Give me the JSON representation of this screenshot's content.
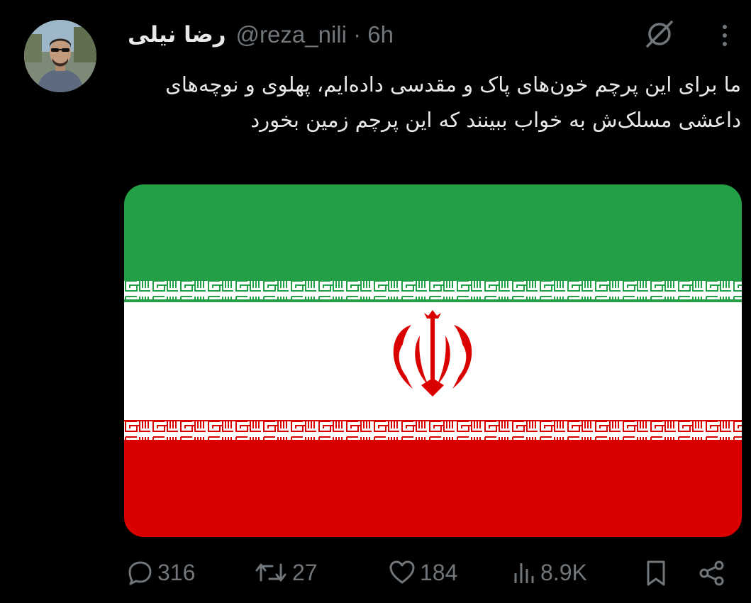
{
  "tweet": {
    "display_name": "رضا نیلی",
    "handle": "@reza_nili",
    "separator": "·",
    "time": "6h",
    "text": "ما برای این پرچم خون‌های پاک و مقدسی داده‌ایم، پهلوی و نوچه‌های داعشی مسلک‌ش به خواب ببینند که این پرچم زمین بخورد",
    "icons": {
      "grok": "grok-icon",
      "more": "more-vertical-icon"
    }
  },
  "media": {
    "description_colors": {
      "green": "#23a045",
      "white": "#ffffff",
      "red": "#da0000"
    }
  },
  "actions": {
    "replies": "316",
    "retweets": "27",
    "likes": "184",
    "views": "8.9K",
    "icons": [
      "reply-icon",
      "retweet-icon",
      "like-icon",
      "views-icon",
      "bookmark-icon",
      "share-icon"
    ]
  },
  "colors": {
    "background": "#000000",
    "text": "#e7e9ea",
    "muted": "#71767b"
  }
}
